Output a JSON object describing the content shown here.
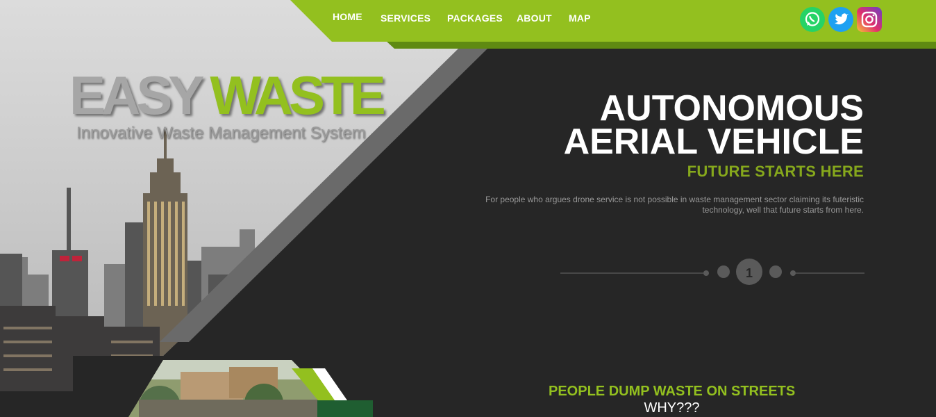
{
  "nav": {
    "items": [
      {
        "label": "HOME"
      },
      {
        "label": "SERVICES"
      },
      {
        "label": "PACKAGES"
      },
      {
        "label": "ABOUT"
      },
      {
        "label": "MAP"
      }
    ]
  },
  "social": [
    {
      "name": "whatsapp",
      "icon": "whatsapp-icon",
      "color": "#25d366"
    },
    {
      "name": "twitter",
      "icon": "twitter-icon",
      "color": "#1da1f2"
    },
    {
      "name": "instagram",
      "icon": "instagram-icon",
      "color": "#c13584"
    }
  ],
  "brand": {
    "part1": "EASY",
    "part2": "WASTE",
    "tagline": "Innovative Waste Management System"
  },
  "hero": {
    "headline_line1": "AUTONOMOUS",
    "headline_line2": "AERIAL VEHICLE",
    "subheadline": "FUTURE STARTS HERE",
    "description": "For people who argues drone service is not possible in waste management sector claiming its futeristic technology, well that future starts from here."
  },
  "slider": {
    "current": "1"
  },
  "section": {
    "title": "PEOPLE DUMP WASTE ON STREETS",
    "subtitle": "WHY???"
  },
  "colors": {
    "accent_green": "#93c01f",
    "dark_green": "#5f8a12",
    "background": "#262626",
    "grey_stripe": "#6a6a6a"
  }
}
